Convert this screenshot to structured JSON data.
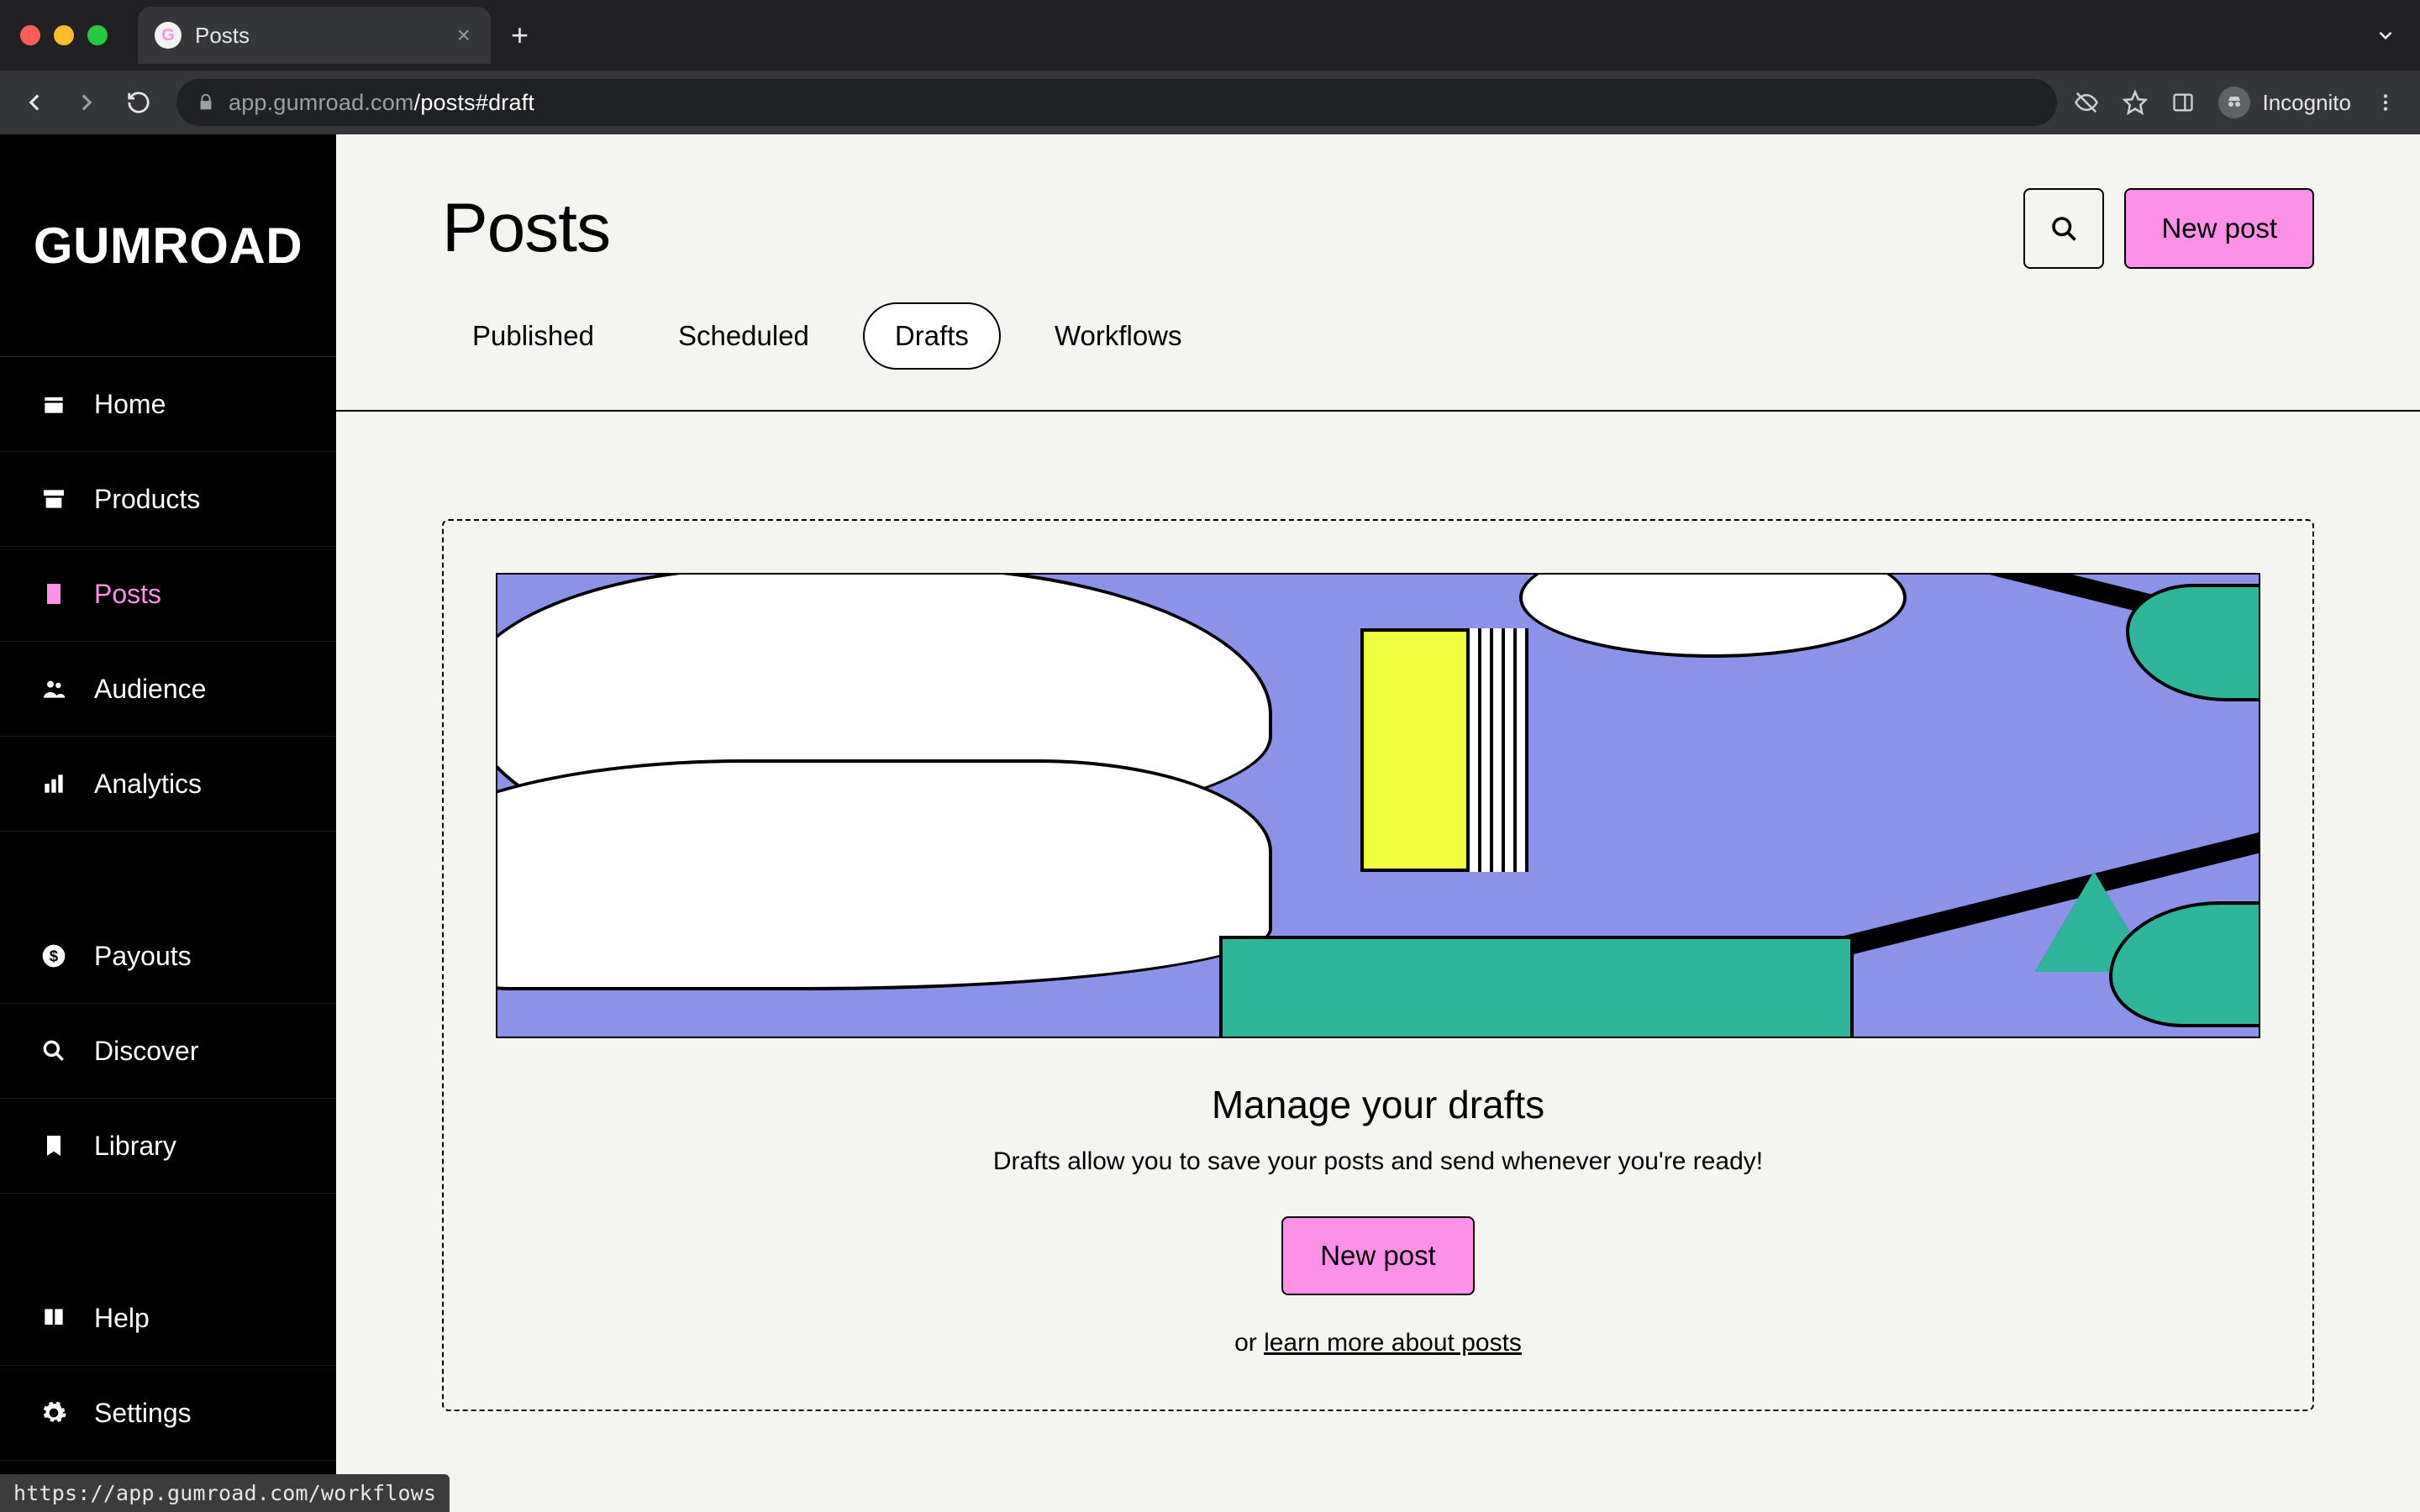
{
  "browser": {
    "tab_title": "Posts",
    "url_display": {
      "domain": "app.gumroad.com",
      "path": "/posts#draft"
    },
    "incognito_label": "Incognito",
    "status_url": "https://app.gumroad.com/workflows"
  },
  "brand": "GUMROAD",
  "sidebar": {
    "items": [
      {
        "id": "home",
        "label": "Home",
        "icon": "home-icon"
      },
      {
        "id": "products",
        "label": "Products",
        "icon": "archive-icon"
      },
      {
        "id": "posts",
        "label": "Posts",
        "icon": "posts-icon",
        "active": true
      },
      {
        "id": "audience",
        "label": "Audience",
        "icon": "people-icon"
      },
      {
        "id": "analytics",
        "label": "Analytics",
        "icon": "chart-icon"
      }
    ],
    "items_lower": [
      {
        "id": "payouts",
        "label": "Payouts",
        "icon": "dollar-icon"
      },
      {
        "id": "discover",
        "label": "Discover",
        "icon": "search-icon"
      },
      {
        "id": "library",
        "label": "Library",
        "icon": "bookmark-icon"
      }
    ],
    "items_footer": [
      {
        "id": "help",
        "label": "Help",
        "icon": "book-icon"
      },
      {
        "id": "settings",
        "label": "Settings",
        "icon": "gear-icon"
      }
    ]
  },
  "page": {
    "title": "Posts",
    "actions": {
      "new_post": "New post"
    },
    "tabs": [
      {
        "id": "published",
        "label": "Published"
      },
      {
        "id": "scheduled",
        "label": "Scheduled"
      },
      {
        "id": "drafts",
        "label": "Drafts",
        "active": true
      },
      {
        "id": "workflows",
        "label": "Workflows"
      }
    ],
    "empty": {
      "heading": "Manage your drafts",
      "subheading": "Drafts allow you to save your posts and send whenever you're ready!",
      "cta": "New post",
      "or_prefix": "or ",
      "learn_more": "learn more about posts"
    }
  },
  "colors": {
    "accent": "#ff90e8",
    "illus_bg": "#8b92e8",
    "illus_green": "#2fb69a",
    "illus_yellow": "#f0ff3f"
  }
}
